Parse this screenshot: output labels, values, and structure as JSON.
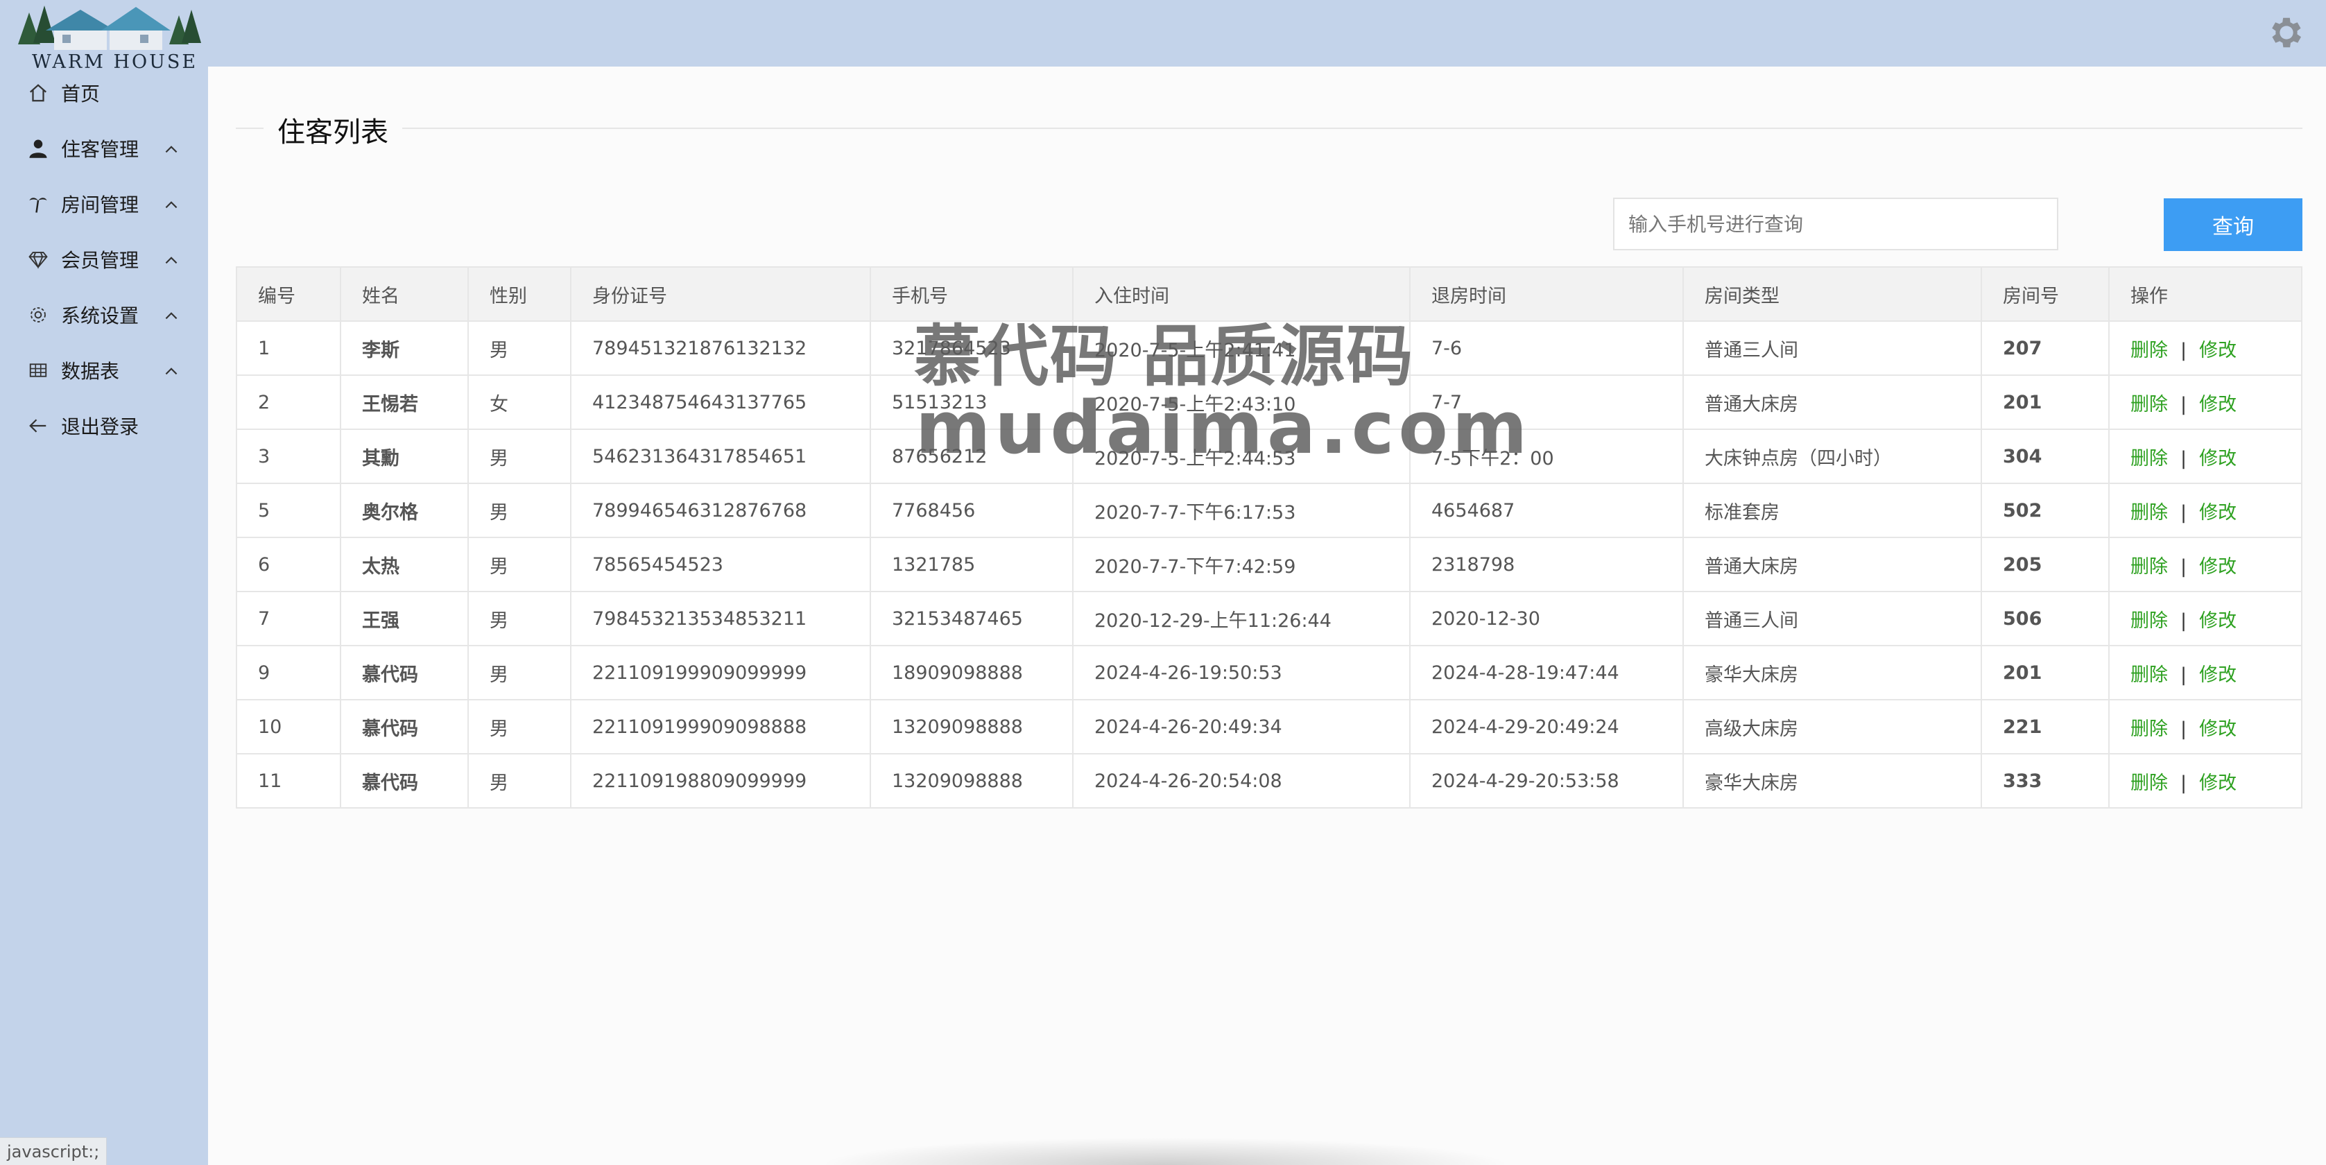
{
  "brand": {
    "logo_text": "WARM HOUSE"
  },
  "sidebar": {
    "items": [
      {
        "label": "首页",
        "icon": "home-icon"
      },
      {
        "label": "住客管理",
        "icon": "user-icon"
      },
      {
        "label": "房间管理",
        "icon": "palm-tree-icon"
      },
      {
        "label": "会员管理",
        "icon": "diamond-icon"
      },
      {
        "label": "系统设置",
        "icon": "gear-icon"
      },
      {
        "label": "数据表",
        "icon": "table-icon"
      },
      {
        "label": "退出登录",
        "icon": "arrow-left-icon"
      }
    ]
  },
  "status_bar": {
    "url": "javascript:;"
  },
  "page": {
    "title": "住客列表"
  },
  "search": {
    "placeholder": "输入手机号进行查询",
    "button_label": "查询"
  },
  "table": {
    "headers": [
      "编号",
      "姓名",
      "性别",
      "身份证号",
      "手机号",
      "入住时间",
      "退房时间",
      "房间类型",
      "房间号",
      "操作"
    ],
    "delete_label": "删除",
    "edit_label": "修改",
    "separator": "|",
    "rows": [
      [
        "1",
        "李斯",
        "男",
        "789451321876132132",
        "3217864523",
        "2020-7-5-上午2:41:41",
        "7-6",
        "普通三人间",
        "207"
      ],
      [
        "2",
        "王惕若",
        "女",
        "412348754643137765",
        "51513213",
        "2020-7-5-上午2:43:10",
        "7-7",
        "普通大床房",
        "201"
      ],
      [
        "3",
        "其勳",
        "男",
        "546231364317854651",
        "87656212",
        "2020-7-5-上午2:44:53",
        "7-5下午2：00",
        "大床钟点房（四小时）",
        "304"
      ],
      [
        "5",
        "奥尔格",
        "男",
        "789946546312876768",
        "7768456",
        "2020-7-7-下午6:17:53",
        "4654687",
        "标准套房",
        "502"
      ],
      [
        "6",
        "太热",
        "男",
        "78565454523",
        "1321785",
        "2020-7-7-下午7:42:59",
        "2318798",
        "普通大床房",
        "205"
      ],
      [
        "7",
        "王强",
        "男",
        "798453213534853211",
        "32153487465",
        "2020-12-29-上午11:26:44",
        "2020-12-30",
        "普通三人间",
        "506"
      ],
      [
        "9",
        "慕代码",
        "男",
        "221109199909099999",
        "18909098888",
        "2024-4-26-19:50:53",
        "2024-4-28-19:47:44",
        "豪华大床房",
        "201"
      ],
      [
        "10",
        "慕代码",
        "男",
        "221109199909098888",
        "13209098888",
        "2024-4-26-20:49:34",
        "2024-4-29-20:49:24",
        "高级大床房",
        "221"
      ],
      [
        "11",
        "慕代码",
        "男",
        "221109198809099999",
        "13209098888",
        "2024-4-26-20:54:08",
        "2024-4-29-20:53:58",
        "豪华大床房",
        "333"
      ]
    ]
  },
  "watermark": {
    "line1": "慕代码 品质源码",
    "line2": "mudaima.com"
  },
  "colors": {
    "sidebar_bg": "#c3d3ea",
    "primary_button": "#3d9df3",
    "action_link": "#2ea121"
  }
}
